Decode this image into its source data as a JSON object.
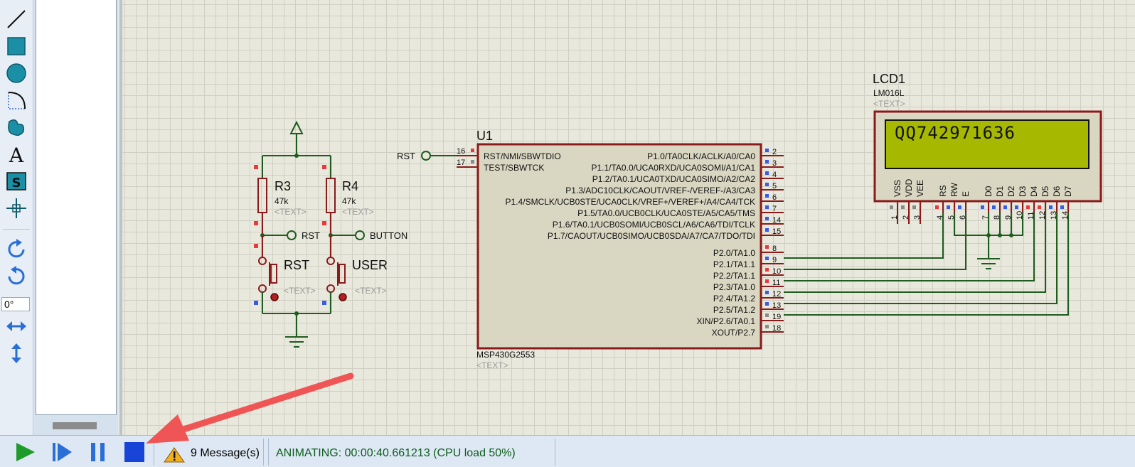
{
  "toolbox": {
    "angle_value": "0°",
    "icons": [
      "line-icon",
      "box-icon",
      "circle-icon",
      "arc-icon",
      "path-icon",
      "text-icon",
      "symbol-icon",
      "marker-icon",
      "rotate-clockwise-icon",
      "rotate-anticlockwise-icon",
      "mirror-horizontal-icon",
      "mirror-vertical-icon"
    ]
  },
  "schematic": {
    "u1": {
      "ref": "U1",
      "value": "MSP430G2553",
      "text": "<TEXT>",
      "left_pins": [
        {
          "num": "16",
          "name": "RST/NMI/SBWTDIO"
        },
        {
          "num": "17",
          "name": "TEST/SBWTCK"
        }
      ],
      "right_pins": [
        {
          "num": "2",
          "name": "P1.0/TA0CLK/ACLK/A0/CA0"
        },
        {
          "num": "3",
          "name": "P1.1/TA0.0/UCA0RXD/UCA0SOMI/A1/CA1"
        },
        {
          "num": "4",
          "name": "P1.2/TA0.1/UCA0TXD/UCA0SIMO/A2/CA2"
        },
        {
          "num": "5",
          "name": "P1.3/ADC10CLK/CAOUT/VREF-/VEREF-/A3/CA3"
        },
        {
          "num": "6",
          "name": "P1.4/SMCLK/UCB0STE/UCA0CLK/VREF+/VEREF+/A4/CA4/TCK"
        },
        {
          "num": "7",
          "name": "P1.5/TA0.0/UCB0CLK/UCA0STE/A5/CA5/TMS"
        },
        {
          "num": "14",
          "name": "P1.6/TA0.1/UCB0SOMI/UCB0SCL/A6/CA6/TDI/TCLK"
        },
        {
          "num": "15",
          "name": "P1.7/CAOUT/UCB0SIMO/UCB0SDA/A7/CA7/TDO/TDI"
        },
        {
          "num": "8",
          "name": "P2.0/TA1.0"
        },
        {
          "num": "9",
          "name": "P2.1/TA1.1"
        },
        {
          "num": "10",
          "name": "P2.2/TA1.1"
        },
        {
          "num": "11",
          "name": "P2.3/TA1.0"
        },
        {
          "num": "12",
          "name": "P2.4/TA1.2"
        },
        {
          "num": "13",
          "name": "P2.5/TA1.2"
        },
        {
          "num": "19",
          "name": "XIN/P2.6/TA0.1"
        },
        {
          "num": "18",
          "name": "XOUT/P2.7"
        }
      ]
    },
    "rst_terminal": "RST",
    "r3": {
      "ref": "R3",
      "value": "47k",
      "text": "<TEXT>"
    },
    "r4": {
      "ref": "R4",
      "value": "47k",
      "text": "<TEXT>"
    },
    "rst_label": "RST",
    "button_label": "BUTTON",
    "sw_rst": {
      "ref": "RST",
      "text": "<TEXT>"
    },
    "sw_user": {
      "ref": "USER",
      "text": "<TEXT>"
    },
    "lcd": {
      "ref": "LCD1",
      "value": "LM016L",
      "text": "<TEXT>",
      "display": "QQ742971636",
      "pins": [
        {
          "name": "VSS",
          "num": "1"
        },
        {
          "name": "VDD",
          "num": "2"
        },
        {
          "name": "VEE",
          "num": "3"
        },
        {
          "name": "RS",
          "num": "4"
        },
        {
          "name": "RW",
          "num": "5"
        },
        {
          "name": "E",
          "num": "6"
        },
        {
          "name": "D0",
          "num": "7"
        },
        {
          "name": "D1",
          "num": "8"
        },
        {
          "name": "D2",
          "num": "9"
        },
        {
          "name": "D3",
          "num": "10"
        },
        {
          "name": "D4",
          "num": "11"
        },
        {
          "name": "D5",
          "num": "12"
        },
        {
          "name": "D6",
          "num": "13"
        },
        {
          "name": "D7",
          "num": "14"
        }
      ]
    }
  },
  "statusbar": {
    "messages": "9 Message(s)",
    "animation_status": "ANIMATING: 00:00:40.661213 (CPU load 50%)"
  },
  "colors": {
    "component_border": "#8b1a1a",
    "component_fill": "#d9d6c2",
    "wire": "#1f5c1f",
    "lcd_screen": "#a6b800",
    "annotation_arrow": "#f05555",
    "pin_red": "#e83a3a",
    "pin_blue": "#3a5ae8",
    "pin_grey": "#8a8a8a"
  }
}
